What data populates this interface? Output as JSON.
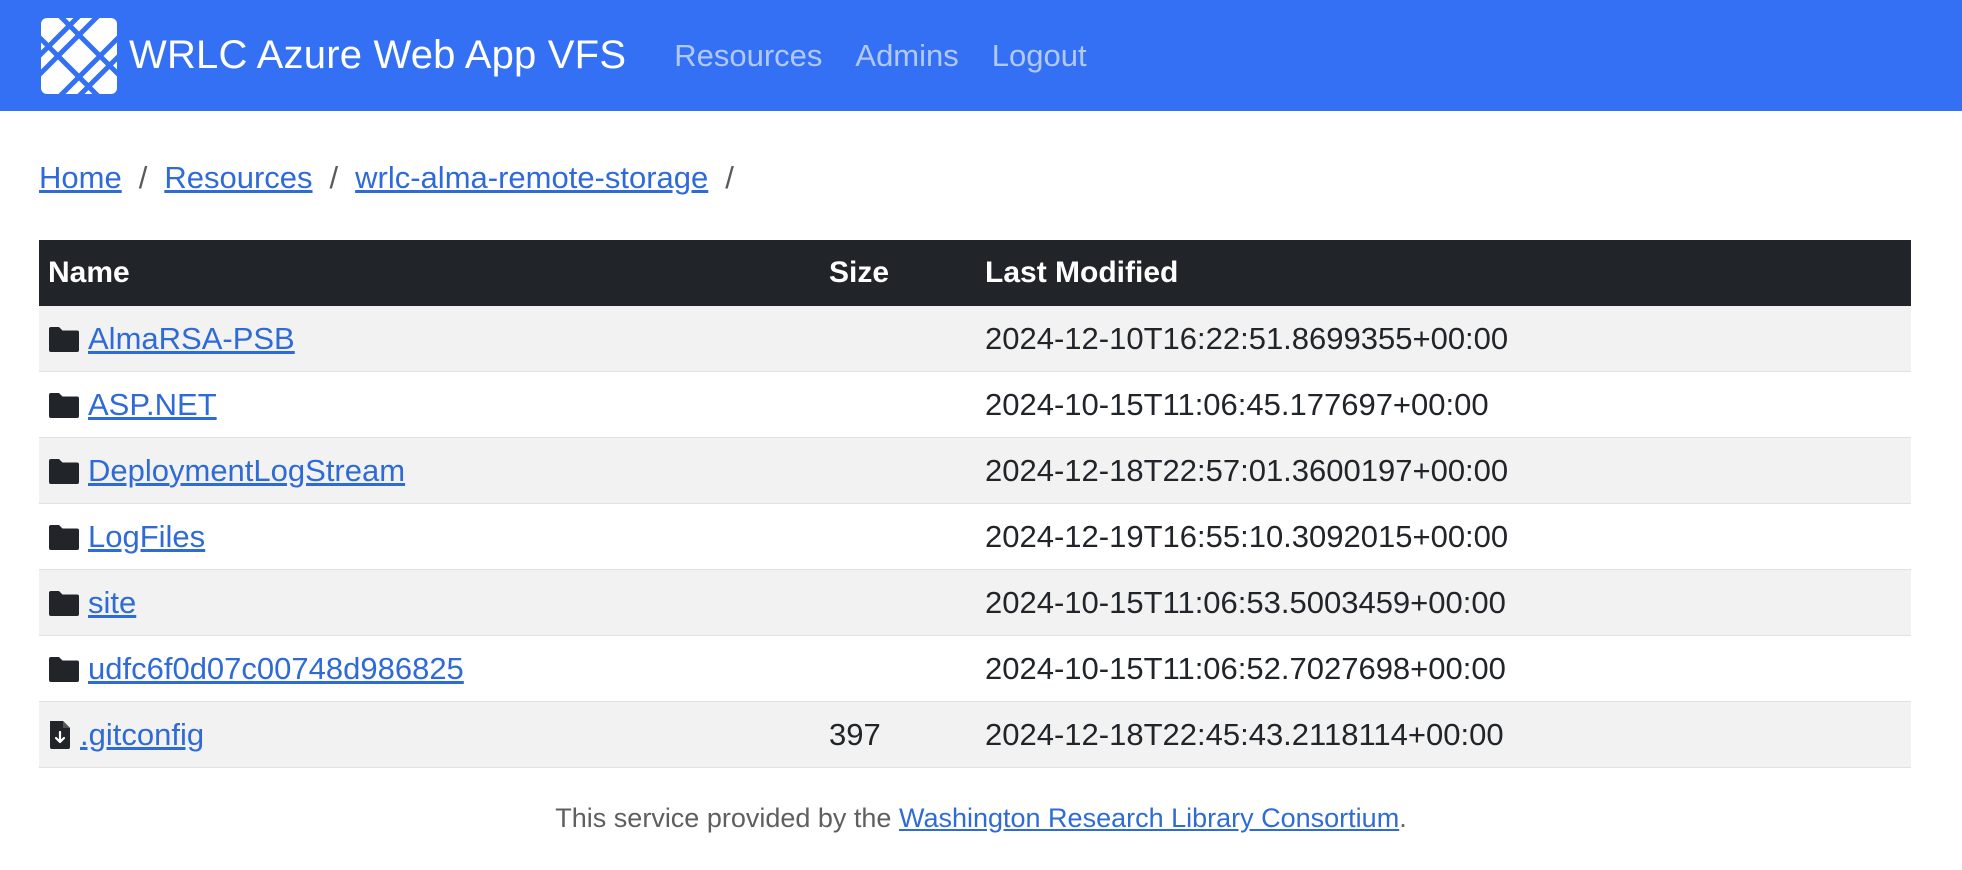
{
  "navbar": {
    "brand_title": "WRLC Azure Web App VFS",
    "links": [
      "Resources",
      "Admins",
      "Logout"
    ],
    "background_color": "#3470f3"
  },
  "breadcrumb": {
    "items": [
      "Home",
      "Resources",
      "wrlc-alma-remote-storage"
    ],
    "separator": "/"
  },
  "table": {
    "headers": {
      "name": "Name",
      "size": "Size",
      "modified": "Last Modified"
    },
    "rows": [
      {
        "type": "folder-icon",
        "name": "AlmaRSA-PSB",
        "size": "",
        "modified": "2024-12-10T16:22:51.8699355+00:00"
      },
      {
        "type": "folder-icon",
        "name": "ASP.NET",
        "size": "",
        "modified": "2024-10-15T11:06:45.177697+00:00"
      },
      {
        "type": "folder-icon",
        "name": "DeploymentLogStream",
        "size": "",
        "modified": "2024-12-18T22:57:01.3600197+00:00"
      },
      {
        "type": "folder-icon",
        "name": "LogFiles",
        "size": "",
        "modified": "2024-12-19T16:55:10.3092015+00:00"
      },
      {
        "type": "folder-icon",
        "name": "site",
        "size": "",
        "modified": "2024-10-15T11:06:53.5003459+00:00"
      },
      {
        "type": "folder-icon",
        "name": "udfc6f0d07c00748d986825",
        "size": "",
        "modified": "2024-10-15T11:06:52.7027698+00:00"
      },
      {
        "type": "file-download-icon",
        "name": ".gitconfig",
        "size": "397",
        "modified": "2024-12-18T22:45:43.2118114+00:00"
      }
    ]
  },
  "footer": {
    "prefix": "This service provided by the ",
    "link_text": "Washington Research Library Consortium",
    "suffix": "."
  }
}
